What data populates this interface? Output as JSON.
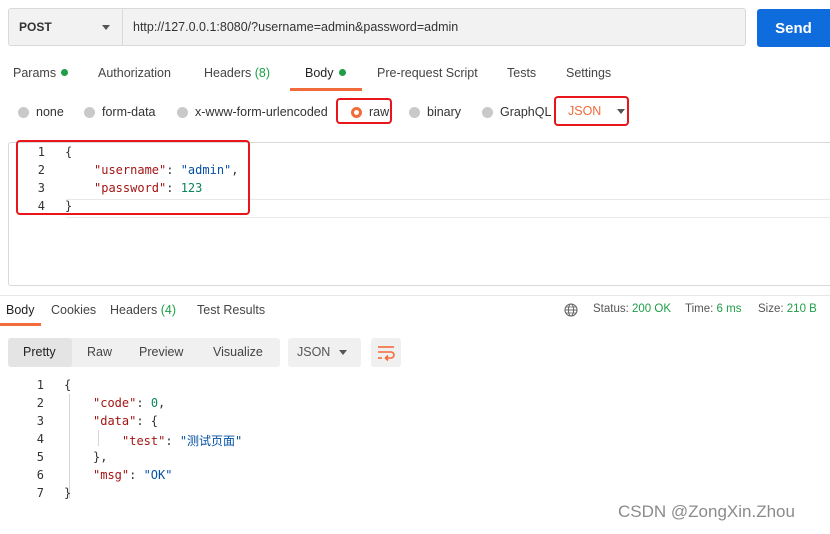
{
  "request": {
    "method": "POST",
    "url": "http://127.0.0.1:8080/?username=admin&password=admin",
    "send_label": "Send"
  },
  "request_tabs": {
    "params": "Params",
    "authorization": "Authorization",
    "headers": "Headers",
    "headers_count": "(8)",
    "body": "Body",
    "prerequest": "Pre-request Script",
    "tests": "Tests",
    "settings": "Settings"
  },
  "body_types": {
    "none": "none",
    "form_data": "form-data",
    "urlencoded": "x-www-form-urlencoded",
    "raw": "raw",
    "binary": "binary",
    "graphql": "GraphQL",
    "format": "JSON",
    "selected": "raw"
  },
  "request_body": {
    "line_numbers": [
      "1",
      "2",
      "3",
      "4"
    ],
    "open": "{",
    "l2_key": "\"username\"",
    "l2_sep": ": ",
    "l2_val": "\"admin\"",
    "l2_end": ",",
    "l3_key": "\"password\"",
    "l3_sep": ": ",
    "l3_val": "123",
    "close": "}"
  },
  "response_tabs": {
    "body": "Body",
    "cookies": "Cookies",
    "headers": "Headers",
    "headers_count": "(4)",
    "test_results": "Test Results"
  },
  "response_status": {
    "status_label": "Status:",
    "status_value": "200 OK",
    "time_label": "Time:",
    "time_value": "6 ms",
    "size_label": "Size:",
    "size_value": "210 B"
  },
  "response_view": {
    "pretty": "Pretty",
    "raw": "Raw",
    "preview": "Preview",
    "visualize": "Visualize",
    "format": "JSON"
  },
  "response_body": {
    "line_numbers": [
      "1",
      "2",
      "3",
      "4",
      "5",
      "6",
      "7"
    ],
    "open": "{",
    "code_key": "\"code\"",
    "code_sep": ": ",
    "code_val": "0",
    "code_end": ",",
    "data_key": "\"data\"",
    "data_sep": ": {",
    "test_key": "\"test\"",
    "test_sep": ": ",
    "test_val": "\"测试页面\"",
    "data_close": "},",
    "msg_key": "\"msg\"",
    "msg_sep": ": ",
    "msg_val": "\"OK\"",
    "close": "}"
  },
  "watermark": "CSDN @ZongXin.Zhou",
  "colors": {
    "accent": "#f26b3a",
    "send": "#0f6cdc",
    "success": "#1e9e47",
    "highlight_box": "#e8151b"
  }
}
